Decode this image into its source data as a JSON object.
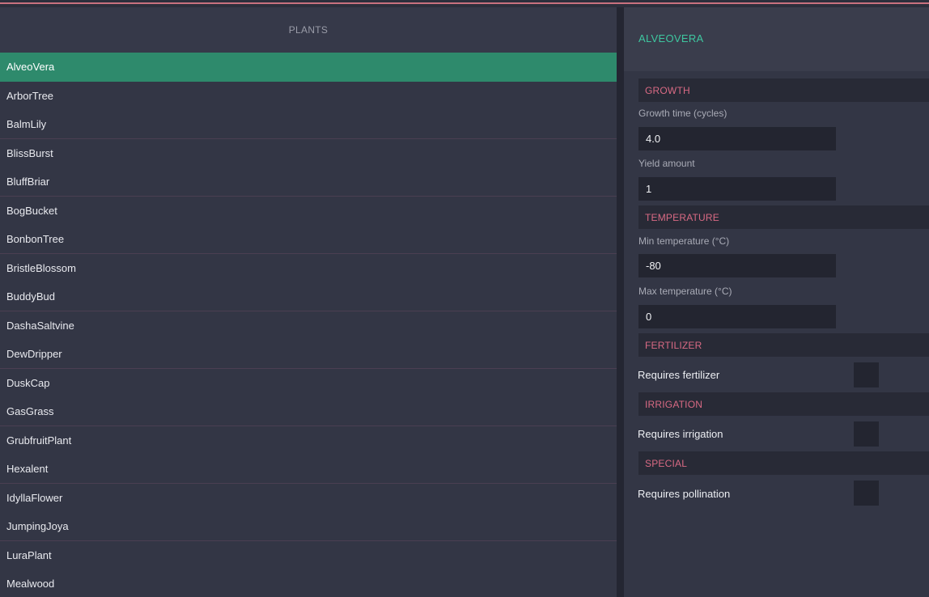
{
  "left_panel": {
    "header": "PLANTS",
    "items": [
      "AlveoVera",
      "ArborTree",
      "BalmLily",
      "BlissBurst",
      "BluffBriar",
      "BogBucket",
      "BonbonTree",
      "BristleBlossom",
      "BuddyBud",
      "DashaSaltvine",
      "DewDripper",
      "DuskCap",
      "GasGrass",
      "GrubfruitPlant",
      "Hexalent",
      "IdyllaFlower",
      "JumpingJoya",
      "LuraPlant",
      "Mealwood"
    ],
    "selected": "AlveoVera"
  },
  "detail": {
    "title": "ALVEOVERA",
    "growth": {
      "section": "GROWTH",
      "growth_time_label": "Growth time (cycles)",
      "growth_time_value": "4.0",
      "yield_label": "Yield amount",
      "yield_value": "1"
    },
    "temperature": {
      "section": "TEMPERATURE",
      "min_label": "Min temperature (°C)",
      "min_value": "-80",
      "max_label": "Max temperature (°C)",
      "max_value": "0"
    },
    "fertilizer": {
      "section": "FERTILIZER",
      "label": "Requires fertilizer",
      "checked": false
    },
    "irrigation": {
      "section": "IRRIGATION",
      "label": "Requires irrigation",
      "checked": false
    },
    "special": {
      "section": "SPECIAL",
      "label": "Requires pollination",
      "checked": false
    }
  },
  "colors": {
    "accent_selected": "#2e8a6c",
    "title_teal": "#3ec7a0",
    "section_pink": "#d96a84",
    "top_line": "#c9717f"
  }
}
